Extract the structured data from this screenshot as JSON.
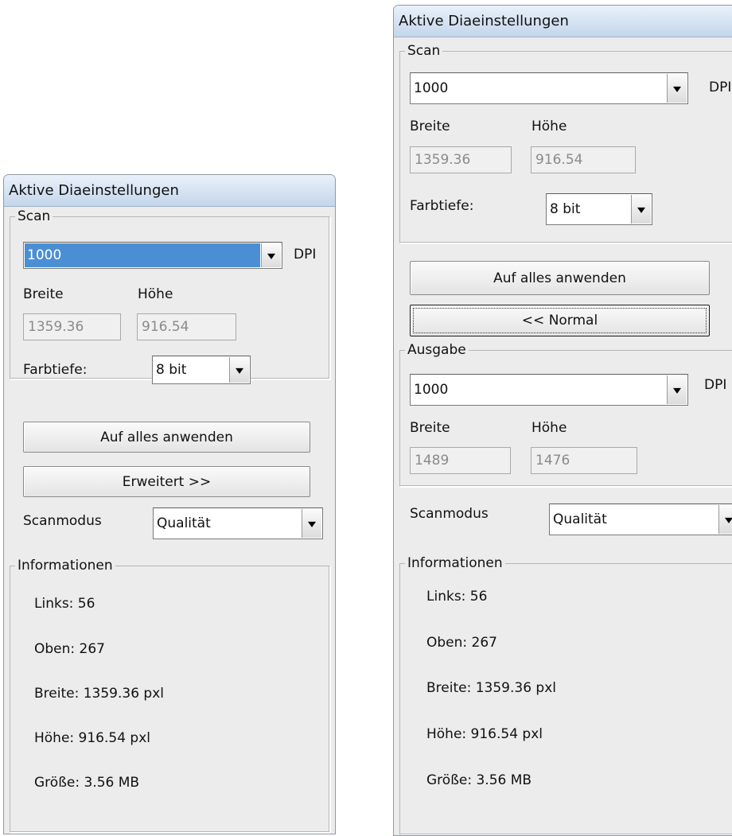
{
  "left": {
    "title": "Aktive Diaeinstellungen",
    "scan": {
      "label": "Scan",
      "dpi_value": "1000",
      "dpi_unit": "DPI",
      "width_label": "Breite",
      "height_label": "Höhe",
      "width_value": "1359.36",
      "height_value": "916.54",
      "depth_label": "Farbtiefe:",
      "depth_value": "8 bit"
    },
    "apply_all_label": "Auf alles anwenden",
    "advanced_label": "Erweitert >>",
    "scanmode_label": "Scanmodus",
    "scanmode_value": "Qualität",
    "info": {
      "label": "Informationen",
      "links": "Links: 56",
      "oben": "Oben: 267",
      "breite": "Breite: 1359.36 pxl",
      "hoehe": "Höhe: 916.54 pxl",
      "groesse": "Größe: 3.56 MB"
    }
  },
  "right": {
    "title": "Aktive Diaeinstellungen",
    "scan": {
      "label": "Scan",
      "dpi_value": "1000",
      "dpi_unit": "DPI",
      "width_label": "Breite",
      "height_label": "Höhe",
      "width_value": "1359.36",
      "height_value": "916.54",
      "depth_label": "Farbtiefe:",
      "depth_value": "8 bit"
    },
    "apply_all_label": "Auf alles anwenden",
    "normal_label": "<< Normal",
    "output": {
      "label": "Ausgabe",
      "dpi_value": "1000",
      "dpi_unit": "DPI",
      "width_label": "Breite",
      "height_label": "Höhe",
      "width_value": "1489",
      "height_value": "1476"
    },
    "scanmode_label": "Scanmodus",
    "scanmode_value": "Qualität",
    "info": {
      "label": "Informationen",
      "links": "Links: 56",
      "oben": "Oben: 267",
      "breite": "Breite: 1359.36 pxl",
      "hoehe": "Höhe: 916.54 pxl",
      "groesse": "Größe: 3.56 MB"
    }
  }
}
